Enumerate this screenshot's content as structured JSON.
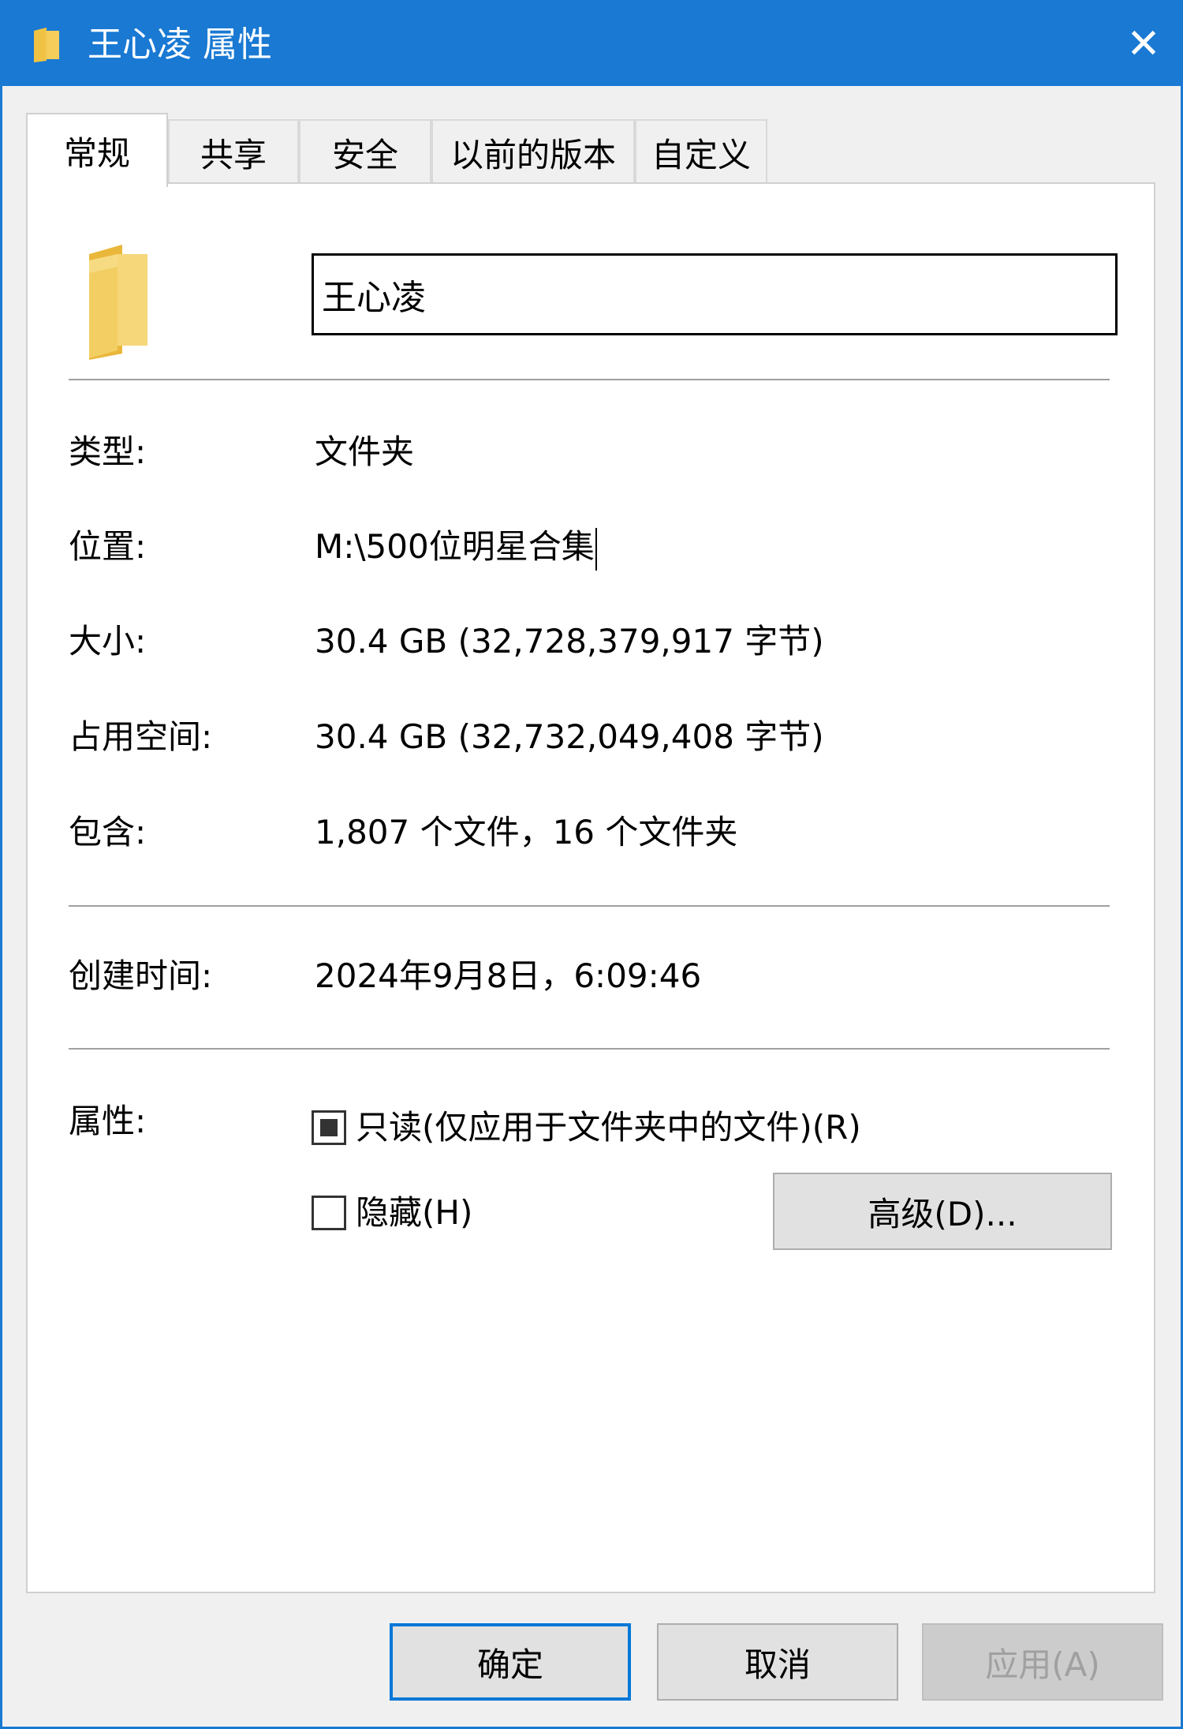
{
  "window": {
    "title": "王心凌 属性",
    "close_glyph": "✕",
    "accent_color": "#1979d3"
  },
  "tabs": [
    {
      "label": "常规",
      "active": true
    },
    {
      "label": "共享",
      "active": false
    },
    {
      "label": "安全",
      "active": false
    },
    {
      "label": "以前的版本",
      "active": false
    },
    {
      "label": "自定义",
      "active": false
    }
  ],
  "general": {
    "folder_icon": "folder-icon",
    "name_value": "王心凌",
    "rows": {
      "type": {
        "label": "类型:",
        "value": "文件夹"
      },
      "location": {
        "label": "位置:",
        "value": "M:\\500位明星合集"
      },
      "size": {
        "label": "大小:",
        "value": "30.4 GB (32,728,379,917 字节)"
      },
      "size_on_disk": {
        "label": "占用空间:",
        "value": "30.4 GB (32,732,049,408 字节)"
      },
      "contains": {
        "label": "包含:",
        "value": "1,807 个文件，16 个文件夹"
      },
      "created": {
        "label": "创建时间:",
        "value": "2024年9月8日，6:09:46"
      }
    },
    "attributes": {
      "label": "属性:",
      "readonly": {
        "label": "只读(仅应用于文件夹中的文件)(R)",
        "state": "indeterminate"
      },
      "hidden": {
        "label": "隐藏(H)",
        "state": "unchecked"
      },
      "advanced_button": "高级(D)..."
    }
  },
  "buttons": {
    "ok": "确定",
    "cancel": "取消",
    "apply": "应用(A)"
  }
}
